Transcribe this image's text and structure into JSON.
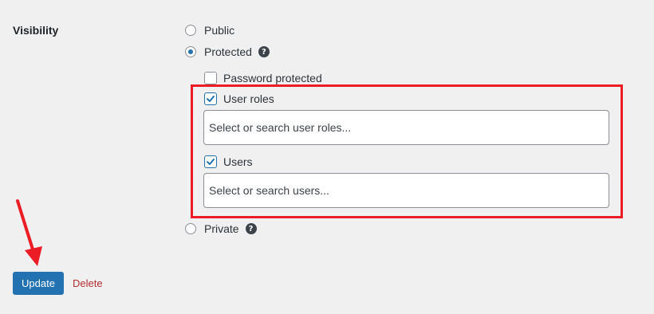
{
  "section": {
    "label": "Visibility"
  },
  "visibility_options": {
    "public": {
      "label": "Public",
      "checked": false
    },
    "protected": {
      "label": "Protected",
      "checked": true,
      "help_icon": "question-circle-icon"
    },
    "private": {
      "label": "Private",
      "checked": false,
      "help_icon": "question-circle-icon"
    }
  },
  "protection": {
    "password": {
      "label": "Password protected",
      "checked": false
    },
    "user_roles": {
      "label": "User roles",
      "checked": true,
      "placeholder": "Select or search user roles..."
    },
    "users": {
      "label": "Users",
      "checked": true,
      "placeholder": "Select or search users..."
    }
  },
  "actions": {
    "update_label": "Update",
    "delete_label": "Delete"
  },
  "annotation": {
    "highlight_color": "#ec1c24",
    "arrow_color": "#ec1c24"
  },
  "colors": {
    "accent": "#2271b1",
    "danger": "#b32d2e",
    "background": "#f0f0f1"
  }
}
